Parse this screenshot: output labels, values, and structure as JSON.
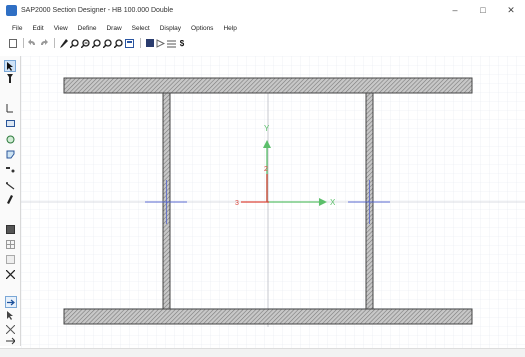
{
  "window": {
    "title": "SAP2000 Section Designer - HB 100.000 Double",
    "controls": [
      "–",
      "□",
      "✕"
    ]
  },
  "menu": [
    "File",
    "Edit",
    "View",
    "Define",
    "Draw",
    "Select",
    "Display",
    "Options",
    "Help"
  ],
  "toolbar": {
    "icons": [
      "new-file-icon",
      "undo-icon",
      "redo-icon",
      "pencil-icon",
      "zoom-window-icon",
      "zoom-in-icon",
      "zoom-out-icon",
      "zoom-previous-icon",
      "pan-icon",
      "refresh-icon",
      "fill-icon",
      "move-icon",
      "properties-icon",
      "dollar-icon"
    ],
    "dollar_label": "$"
  },
  "left_toolbar": {
    "icons": [
      "pointer-icon",
      "reshape-icon",
      "draw-line-icon",
      "draw-rectangle-icon",
      "draw-circle-icon",
      "draw-polygon-icon",
      "draw-section-icon",
      "draw-rebar-icon",
      "draw-reference-icon",
      "fill-icon",
      "grid-icon",
      "snap-icon",
      "layers-icon",
      "select-all-icon",
      "arrow-right-icon",
      "previous-select-icon",
      "clear-select-icon"
    ]
  },
  "axes": {
    "x_label": "X",
    "y_label": "Y",
    "three_label": "3",
    "two_label": "2",
    "colors": {
      "x_axis": "#5cbf6b",
      "y_axis": "#5cbf6b",
      "local_3": "#d9463b",
      "local_2": "#d9463b",
      "section_marker": "#5566cc"
    }
  },
  "status": {
    "left": "",
    "right": ""
  }
}
